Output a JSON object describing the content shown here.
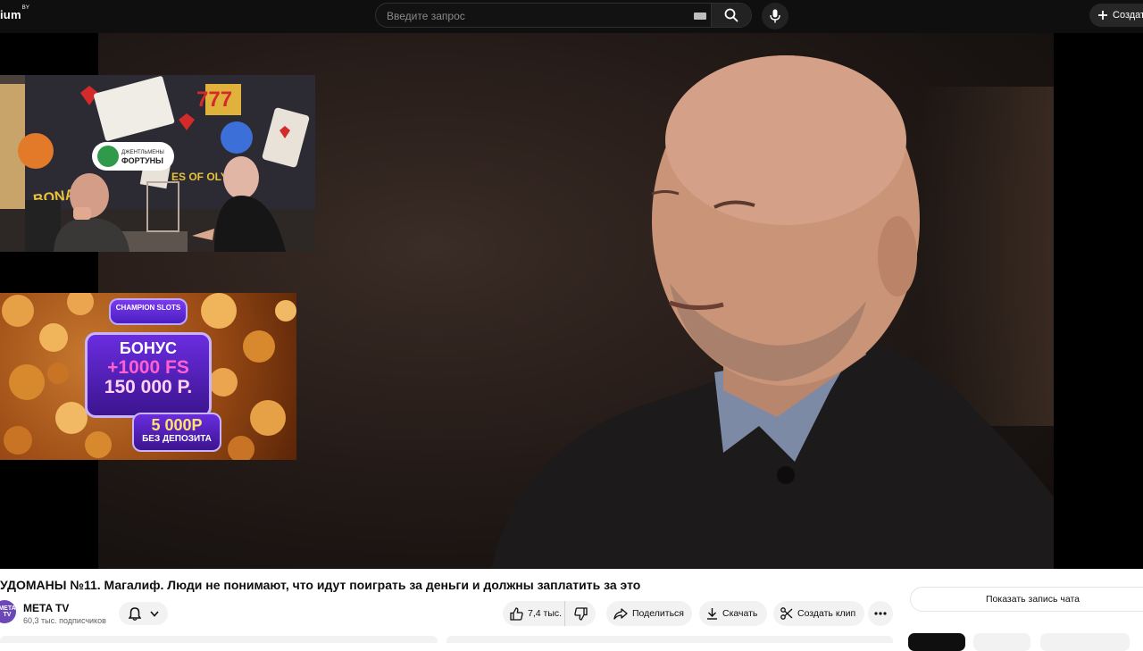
{
  "header": {
    "logo_text": "ium",
    "logo_sup": "BY",
    "search_placeholder": "Введите запрос",
    "create_label": "Создать"
  },
  "ads": {
    "top": {
      "brand": "ДЖЕНТЛЬМЕНЫ ФОРТУНЫ",
      "wall_text_1": "SWEET BONANZA",
      "wall_text_2": "GATES OF OLYMPUS"
    },
    "bottom": {
      "brand": "CHAMPION SLOTS",
      "bonus_title": "БОНУС",
      "bonus_fs": "+1000 FS",
      "bonus_amount": "150 000 Р.",
      "nodeposit_amount": "5 000Р",
      "nodeposit_text": "БЕЗ ДЕПОЗИТА"
    }
  },
  "video": {
    "title": "УДОМАНЫ №11. Магалиф. Люди не понимают, что идут поиграть за деньги и должны заплатить за это"
  },
  "channel": {
    "avatar_text": "META TV",
    "name": "META TV",
    "subscribers": "60,3 тыс. подписчиков"
  },
  "actions": {
    "likes": "7,4 тыс.",
    "share": "Поделиться",
    "download": "Скачать",
    "clip": "Создать клип"
  },
  "sidebar": {
    "show_chat": "Показать запись чата"
  }
}
